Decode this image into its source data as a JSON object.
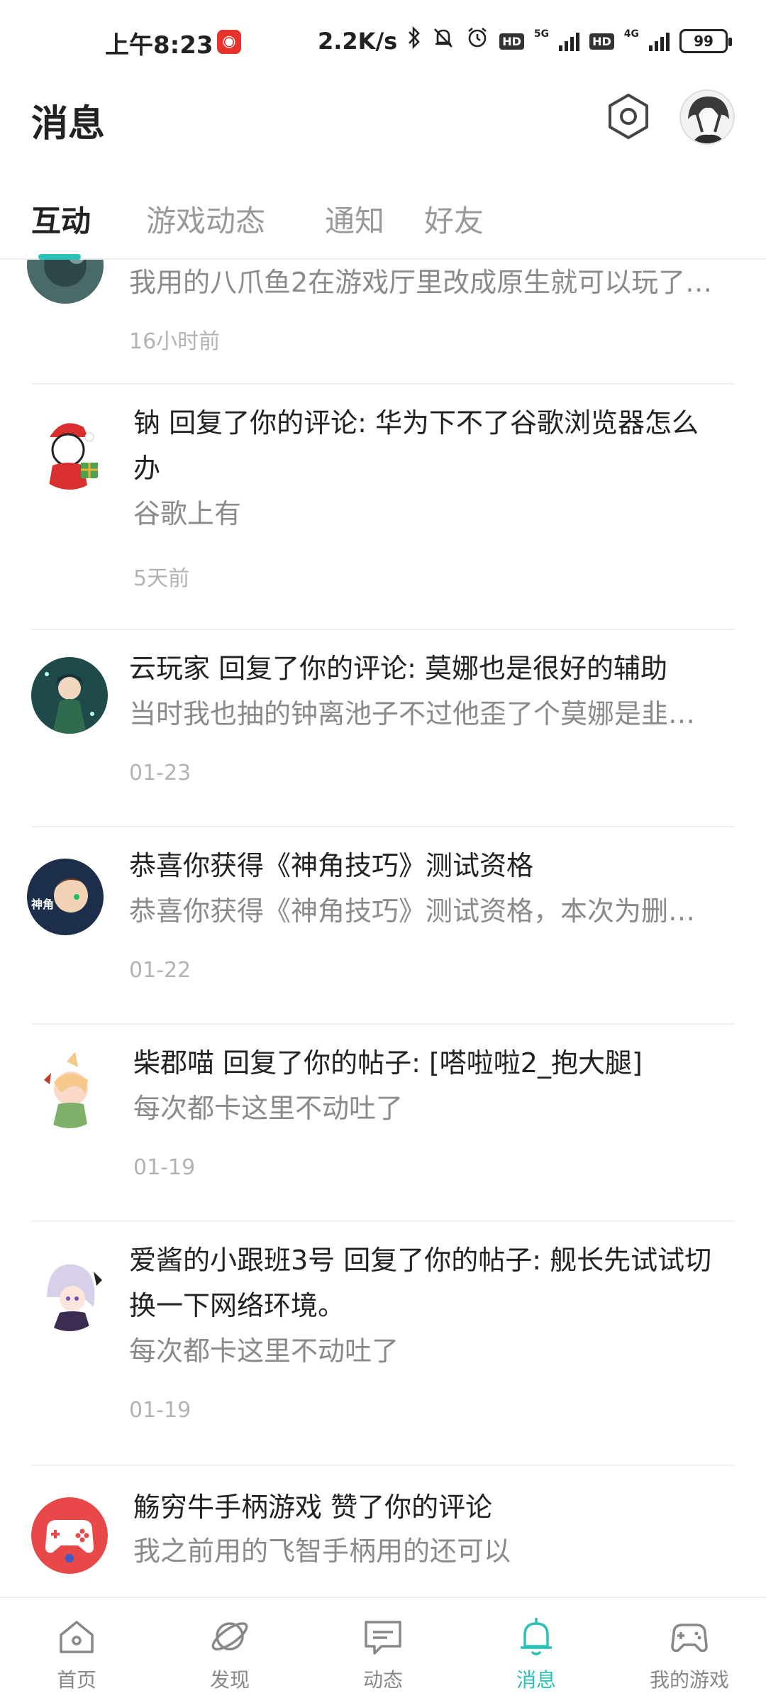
{
  "status_bar": {
    "time": "上午8:23",
    "net_speed": "2.2K/s",
    "hd1": "HD",
    "net1": "5G",
    "hd2": "HD",
    "net2": "4G",
    "battery": "99"
  },
  "header": {
    "title": "消息"
  },
  "tabs": [
    {
      "label": "互动",
      "active": true
    },
    {
      "label": "游戏动态",
      "active": false
    },
    {
      "label": "通知",
      "active": false
    },
    {
      "label": "好友",
      "active": false
    }
  ],
  "messages": [
    {
      "title": "",
      "body": "我用的八爪鱼2在游戏厅里改成原生就可以玩了…",
      "time": "16小时前"
    },
    {
      "title": "钠 回复了你的评论: 华为下不了谷歌浏览器怎么办",
      "title_line1": "钠 回复了你的评论: 华为下不了谷歌浏览器怎么",
      "title_line2": "办",
      "body": "谷歌上有",
      "time": "5天前"
    },
    {
      "title": "云玩家 回复了你的评论: 莫娜也是很好的辅助",
      "body": "当时我也抽的钟离池子不过他歪了个莫娜是韭…",
      "time": "01-23"
    },
    {
      "title": "恭喜你获得《神角技巧》测试资格",
      "body": "恭喜你获得《神角技巧》测试资格，本次为删档…",
      "time": "01-22"
    },
    {
      "title": "柴郡喵 回复了你的帖子: [嗒啦啦2_抱大腿]",
      "body": "每次都卡这里不动吐了",
      "time": "01-19"
    },
    {
      "title_line1": "爱酱的小跟班3号 回复了你的帖子: 舰长先试试切",
      "title_line2": "换一下网络环境。",
      "body": "每次都卡这里不动吐了",
      "time": "01-19"
    },
    {
      "title": "觞穷牛手柄游戏 赞了你的评论",
      "body": "我之前用的飞智手柄用的还可以",
      "time": ""
    }
  ],
  "bottom_nav": [
    {
      "label": "首页",
      "icon": "home-icon",
      "active": false
    },
    {
      "label": "发现",
      "icon": "planet-icon",
      "active": false
    },
    {
      "label": "动态",
      "icon": "chat-icon",
      "active": false
    },
    {
      "label": "消息",
      "icon": "bell-icon",
      "active": true
    },
    {
      "label": "我的游戏",
      "icon": "gamepad-icon",
      "active": false
    }
  ],
  "colors": {
    "accent": "#2bc1b8",
    "text_primary": "#222222",
    "text_secondary": "#8a8a8a",
    "text_time": "#b3b3b3"
  }
}
